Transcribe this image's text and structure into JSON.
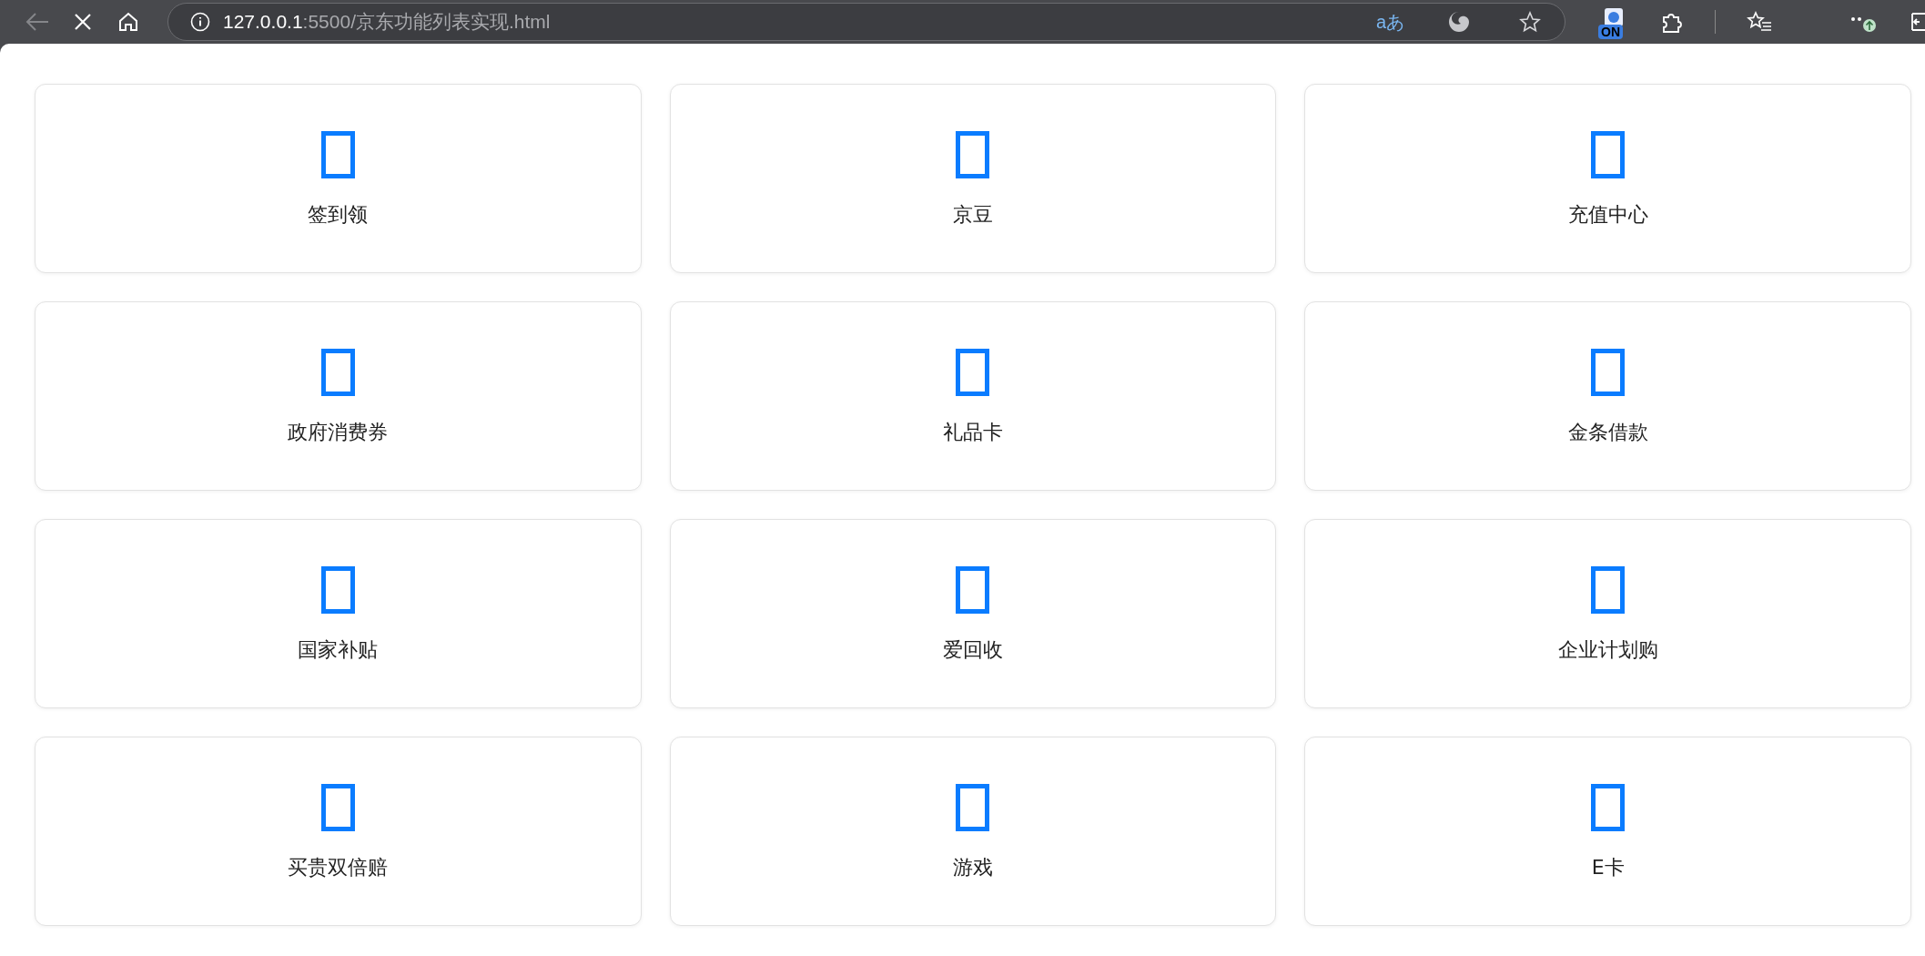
{
  "browser": {
    "url_host": "127.0.0.1",
    "url_path": ":5500/京东功能列表实现.html",
    "translate_label": "aあ",
    "extension_badge": "ON",
    "back_disabled": true
  },
  "features": [
    {
      "label": "签到领"
    },
    {
      "label": "京豆"
    },
    {
      "label": "充值中心"
    },
    {
      "label": "政府消费券"
    },
    {
      "label": "礼品卡"
    },
    {
      "label": "金条借款"
    },
    {
      "label": "国家补贴"
    },
    {
      "label": "爱回收"
    },
    {
      "label": "企业计划购"
    },
    {
      "label": "买贵双倍赔"
    },
    {
      "label": "游戏"
    },
    {
      "label": "E卡"
    }
  ]
}
